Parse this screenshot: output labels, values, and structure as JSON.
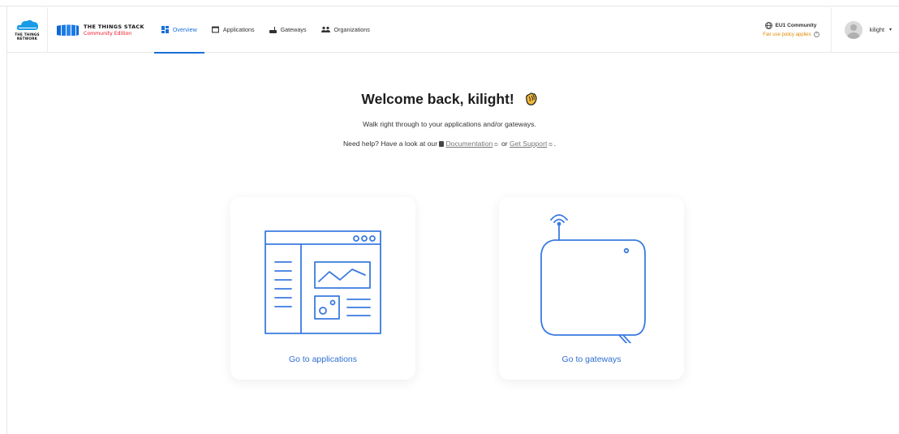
{
  "brand": {
    "ttn_text": "THE THINGS NETWORK",
    "tts_name": "THE THINGS STACK",
    "tts_edition": "Community Edition"
  },
  "nav": {
    "items": [
      {
        "label": "Overview",
        "icon": "dashboard-icon",
        "active": true
      },
      {
        "label": "Applications",
        "icon": "window-icon",
        "active": false
      },
      {
        "label": "Gateways",
        "icon": "router-icon",
        "active": false
      },
      {
        "label": "Organizations",
        "icon": "people-icon",
        "active": false
      }
    ]
  },
  "cluster": {
    "name": "EU1 Community",
    "note": "Fair use policy applies",
    "help_symbol": "?"
  },
  "user": {
    "name": "kilight",
    "caret": "▾"
  },
  "main": {
    "welcome": "Welcome back, kilight!",
    "subtitle": "Walk right through to your applications and/or gateways.",
    "help_prefix": "Need help? Have a look at our",
    "docs_link": "Documentation",
    "help_or": "or",
    "support_link": "Get Support",
    "help_suffix": "."
  },
  "cards": {
    "applications": "Go to applications",
    "gateways": "Go to gateways"
  },
  "colors": {
    "accent": "#1a6fd8",
    "illustration": "#3a7be0",
    "fair_use": "#e08a00",
    "edition": "#e11122"
  }
}
